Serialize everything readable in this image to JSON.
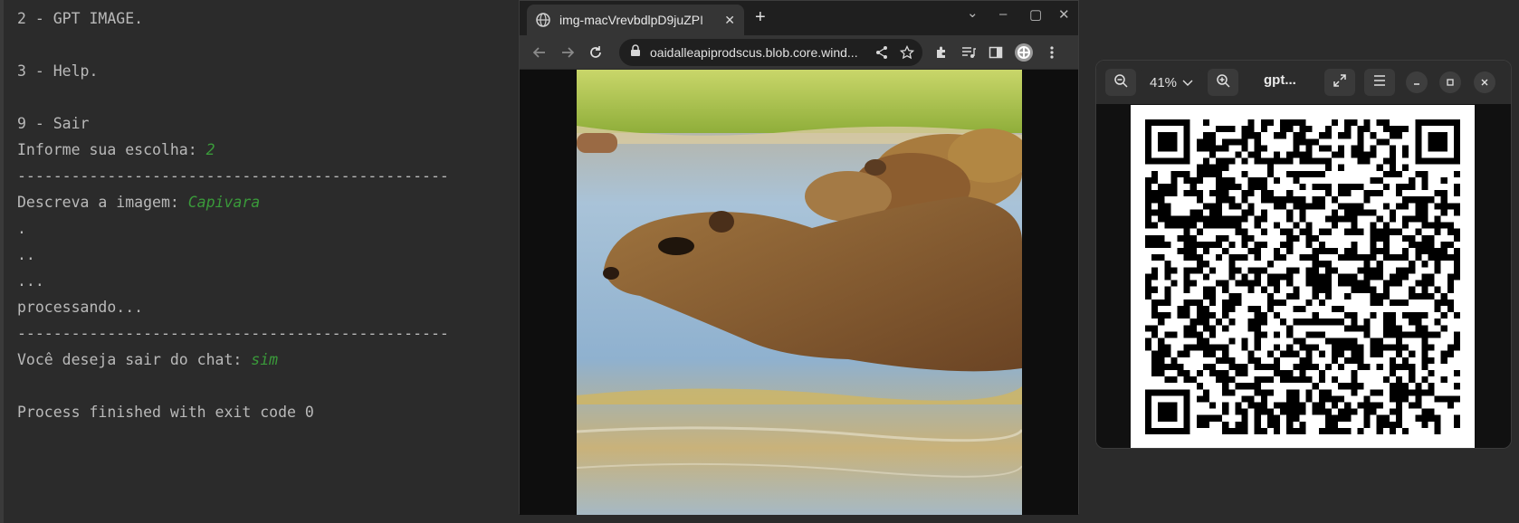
{
  "terminal": {
    "lines": [
      {
        "text": "2 - GPT IMAGE.",
        "input": ""
      },
      {
        "text": "",
        "input": ""
      },
      {
        "text": "3 - Help.",
        "input": ""
      },
      {
        "text": "",
        "input": ""
      },
      {
        "text": "9 - Sair",
        "input": ""
      },
      {
        "text": "Informe sua escolha: ",
        "input": "2"
      },
      {
        "text": "------------------------------------------------",
        "input": ""
      },
      {
        "text": "Descreva a imagem: ",
        "input": "Capivara"
      },
      {
        "text": ".",
        "input": ""
      },
      {
        "text": "..",
        "input": ""
      },
      {
        "text": "...",
        "input": ""
      },
      {
        "text": "processando...",
        "input": ""
      },
      {
        "text": "------------------------------------------------",
        "input": ""
      },
      {
        "text": "Você deseja sair do chat: ",
        "input": "sim"
      },
      {
        "text": "",
        "input": ""
      },
      {
        "text": "Process finished with exit code 0",
        "input": ""
      }
    ]
  },
  "browser": {
    "tab_title": "img-macVrevbdlpD9juZPI",
    "tab_close": "✕",
    "new_tab": "+",
    "url": "oaidalleapiprodscus.blob.core.wind...",
    "window_controls": {
      "dropdown": "⌄",
      "minimize": "–",
      "maximize": "▢",
      "close": "✕"
    },
    "icons": [
      "back-icon",
      "forward-icon",
      "reload-icon",
      "lock-icon",
      "share-icon",
      "star-icon",
      "extensions-icon",
      "media-icon",
      "sidepanel-icon",
      "avatar-icon",
      "more-icon"
    ]
  },
  "pdf": {
    "zoom": "41%",
    "title": "gpt...",
    "colors": {
      "header": "#2c2c2c",
      "page": "#ffffff"
    }
  },
  "colors": {
    "terminal_bg": "#2b2b2b",
    "terminal_text": "#b9b9b9",
    "terminal_input": "#3a9a3a",
    "browser_bg": "#1f1f1f"
  }
}
